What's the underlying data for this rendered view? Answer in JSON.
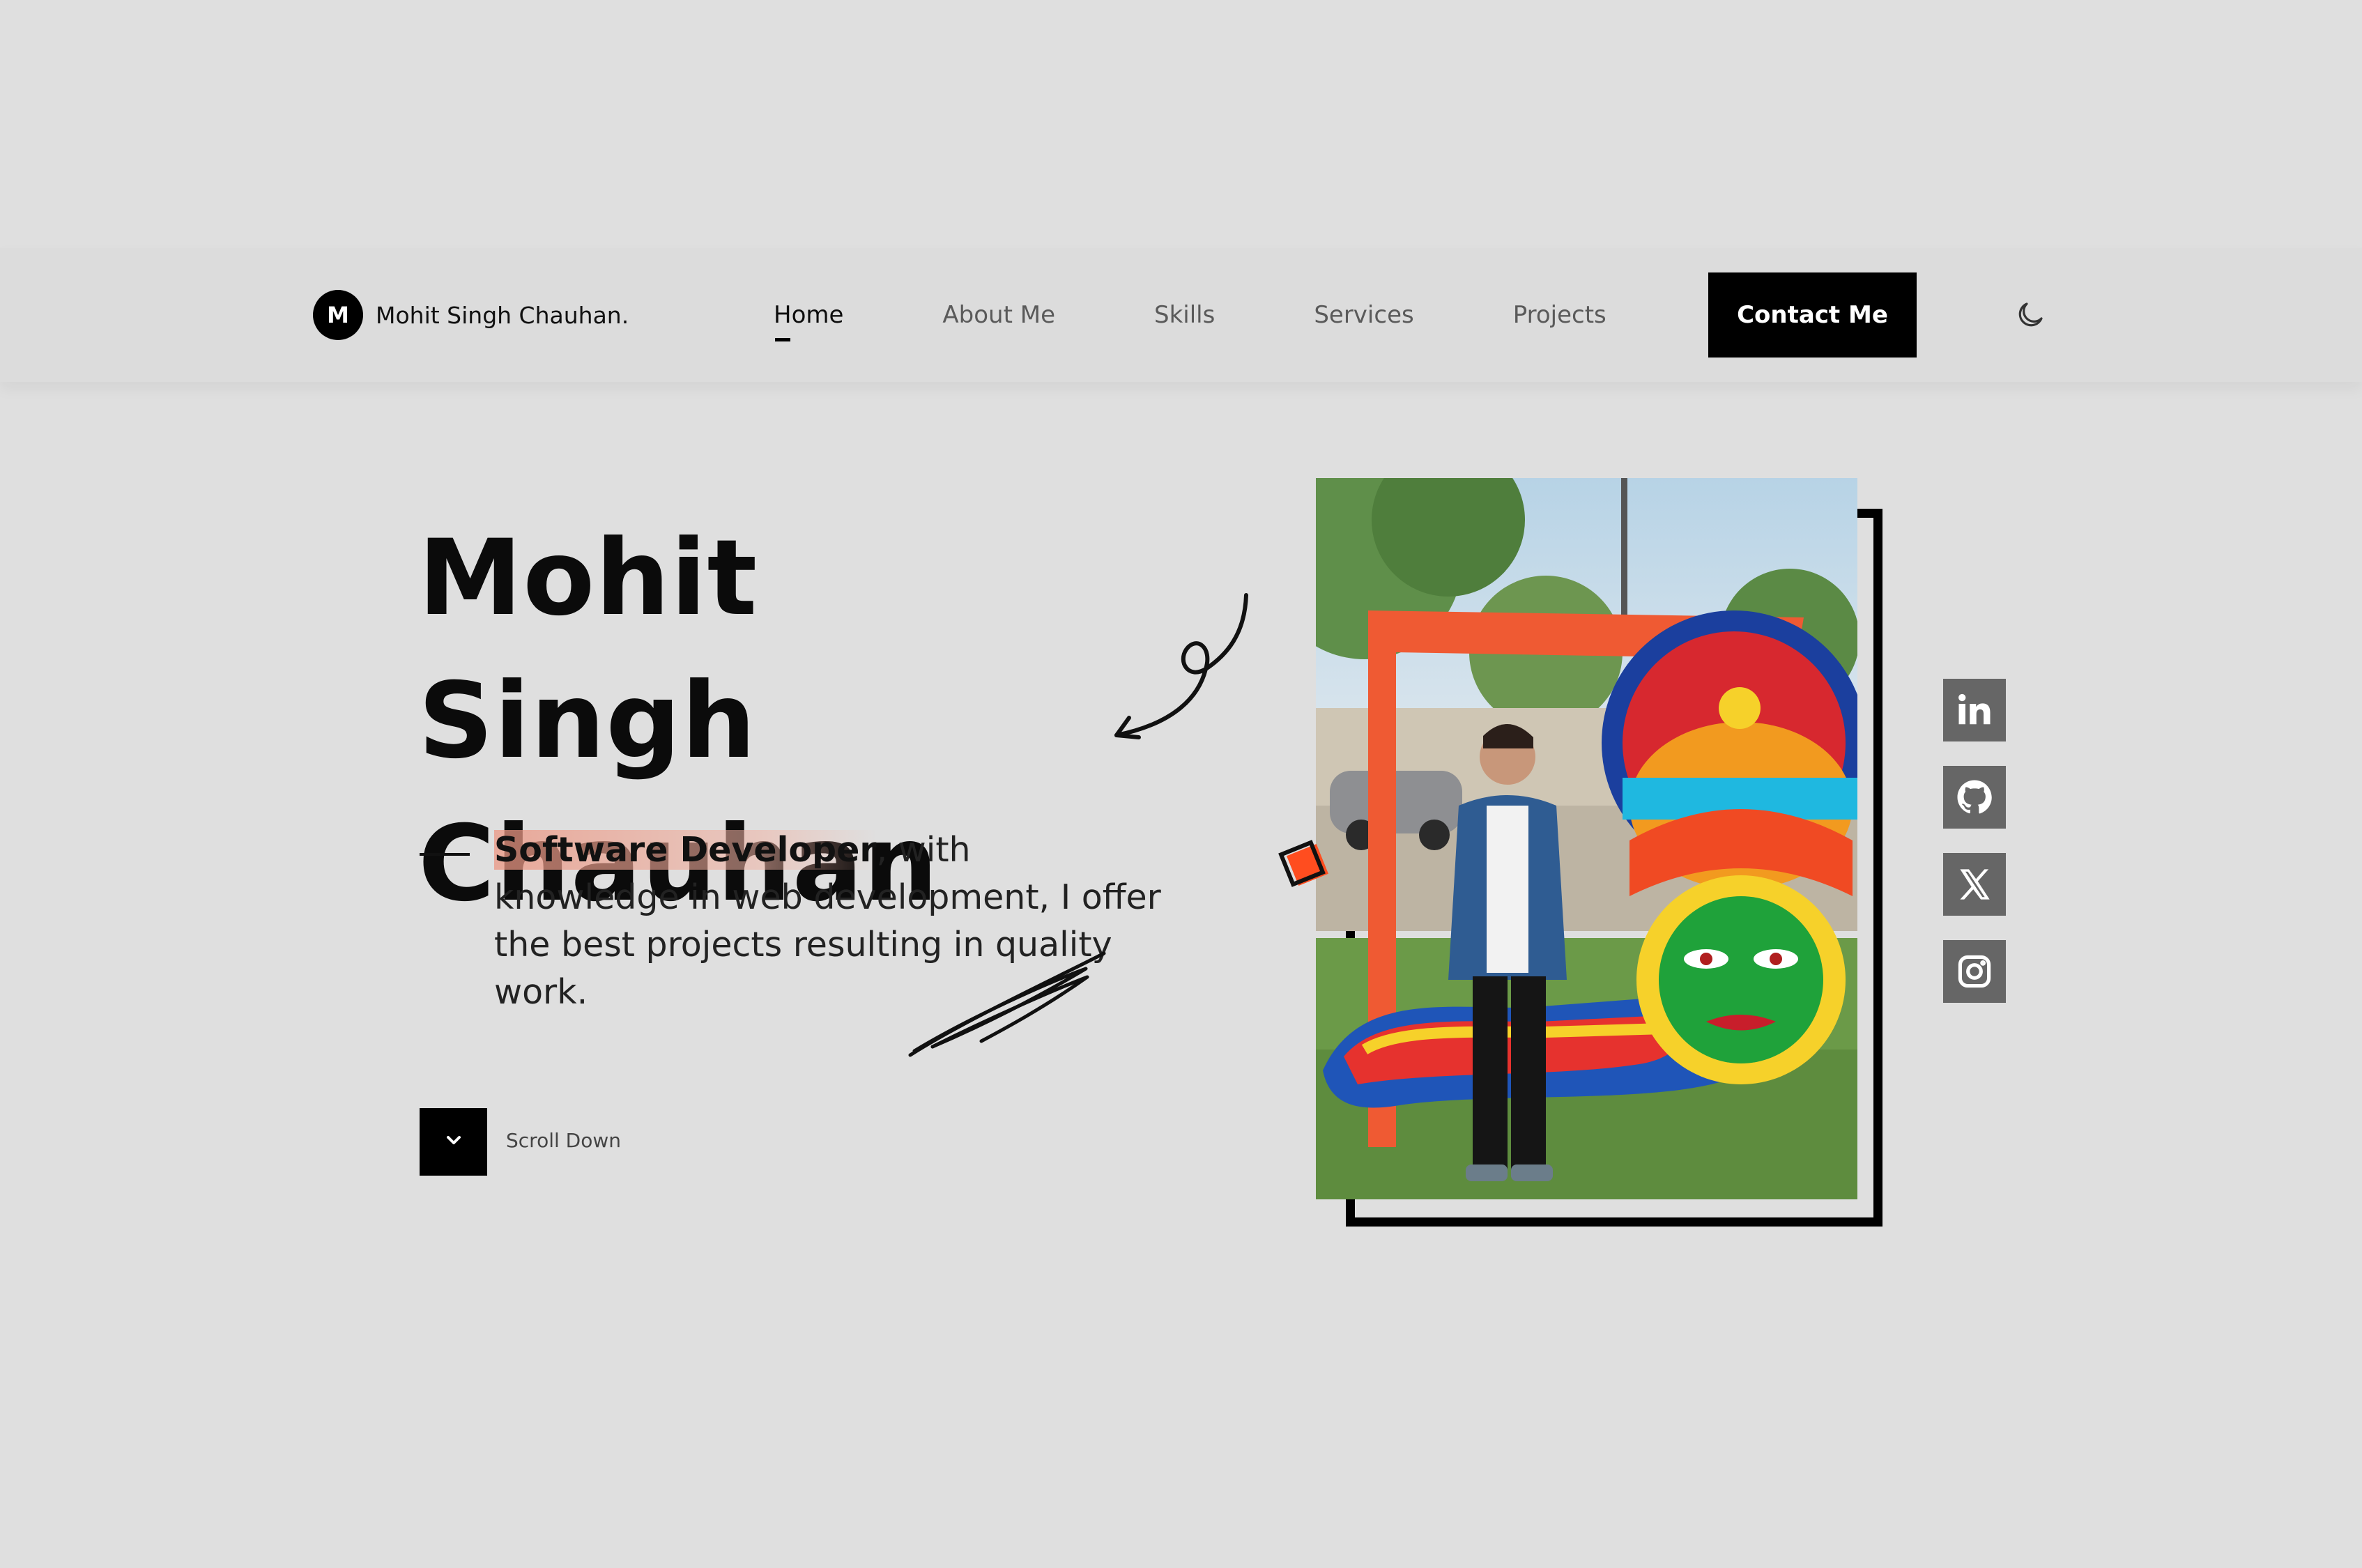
{
  "header": {
    "logo_letter": "M",
    "brand_name": "Mohit Singh Chauhan.",
    "nav": [
      {
        "label": "Home",
        "active": true
      },
      {
        "label": "About Me",
        "active": false
      },
      {
        "label": "Skills",
        "active": false
      },
      {
        "label": "Services",
        "active": false
      },
      {
        "label": "Projects",
        "active": false
      }
    ],
    "contact_label": "Contact Me",
    "theme_icon": "moon-icon"
  },
  "hero": {
    "name_line1": "Mohit Singh",
    "name_line2": "Chauhan",
    "role_highlight": "Software Developer",
    "description_rest": ", with knowledge in web development, I offer the best projects resulting in quality work.",
    "scroll_label": "Scroll Down",
    "scroll_icon": "chevron-down-icon"
  },
  "social": [
    {
      "name": "linkedin-icon"
    },
    {
      "name": "github-icon"
    },
    {
      "name": "x-icon"
    },
    {
      "name": "instagram-icon"
    }
  ],
  "colors": {
    "page_background": "#dfdfdf",
    "header_background": "#dcdcdc",
    "accent": "#ff4d1f",
    "social_button": "#666666",
    "highlight": "#eb9682"
  }
}
